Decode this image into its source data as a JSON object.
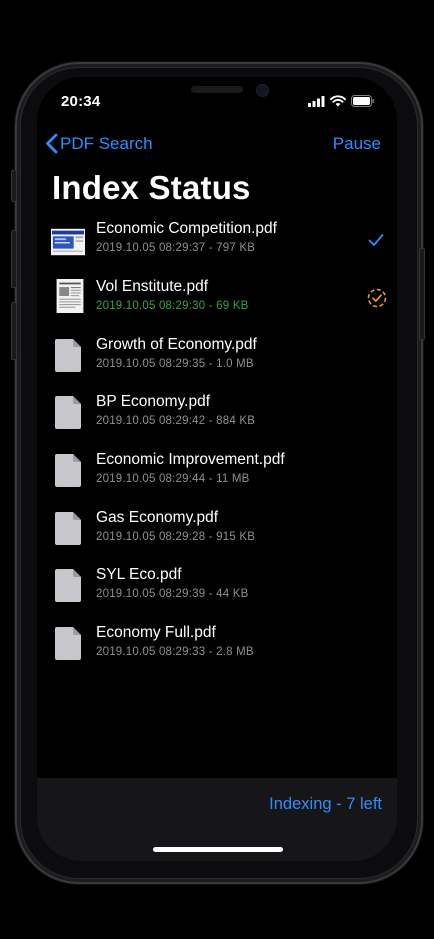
{
  "status_bar": {
    "time": "20:34"
  },
  "nav": {
    "back_label": "PDF Search",
    "action_label": "Pause"
  },
  "page": {
    "title": "Index Status"
  },
  "files": [
    {
      "name": "Economic Competition.pdf",
      "meta": "2019.10.05 08:29:37 - 797 KB",
      "thumb": "color-preview",
      "state": "done"
    },
    {
      "name": "Vol Enstitute.pdf",
      "meta": "2019.10.05 08:29:30 - 69 KB",
      "thumb": "page-preview",
      "state": "indexing"
    },
    {
      "name": "Growth of Economy.pdf",
      "meta": "2019.10.05 08:29:35 - 1.0 MB",
      "thumb": "generic",
      "state": "pending"
    },
    {
      "name": "BP Economy.pdf",
      "meta": "2019.10.05 08:29:42 - 884 KB",
      "thumb": "generic",
      "state": "pending"
    },
    {
      "name": "Economic Improvement.pdf",
      "meta": "2019.10.05 08:29:44 - 11 MB",
      "thumb": "generic",
      "state": "pending"
    },
    {
      "name": "Gas Economy.pdf",
      "meta": "2019.10.05 08:29:28 - 915 KB",
      "thumb": "generic",
      "state": "pending"
    },
    {
      "name": "SYL Eco.pdf",
      "meta": "2019.10.05 08:29:39 - 44 KB",
      "thumb": "generic",
      "state": "pending"
    },
    {
      "name": "Economy Full.pdf",
      "meta": "2019.10.05 08:29:33 - 2.8 MB",
      "thumb": "generic",
      "state": "pending"
    }
  ],
  "footer": {
    "status": "Indexing - 7 left"
  },
  "colors": {
    "accent": "#2f8cff",
    "active_meta": "#34a545",
    "indexing_badge": "#f0962a"
  },
  "icons": {
    "back": "chevron-left-icon",
    "done": "checkmark-icon",
    "indexing": "progress-check-icon",
    "document": "document-icon"
  }
}
